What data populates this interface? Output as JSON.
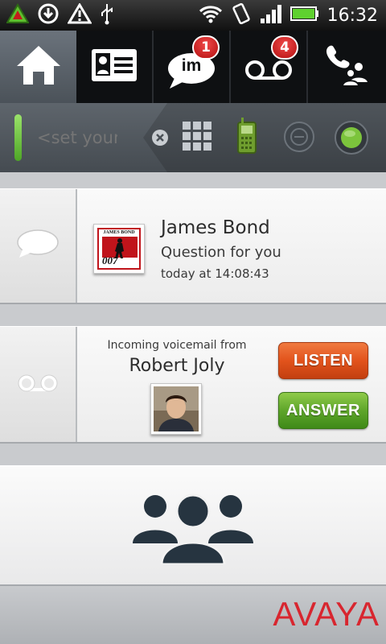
{
  "status_bar": {
    "time": "16:32",
    "icons": [
      "avaya-notification-icon",
      "download-icon",
      "warning-icon",
      "usb-icon",
      "wifi-icon",
      "vibrate-icon",
      "signal-icon",
      "battery-icon"
    ]
  },
  "nav": {
    "tabs": [
      {
        "name": "home",
        "icon": "home-icon"
      },
      {
        "name": "contacts",
        "icon": "contact-card-icon"
      },
      {
        "name": "im",
        "icon": "im-bubble-icon",
        "icon_text": "im",
        "badge": "1"
      },
      {
        "name": "voicemail",
        "icon": "voicemail-icon",
        "badge": "4"
      },
      {
        "name": "calls",
        "icon": "phone-group-icon"
      }
    ]
  },
  "presence": {
    "status_placeholder": "<set your s",
    "icons": [
      "clear-icon",
      "dialpad-icon",
      "mobile-phone-icon",
      "call-forward-icon",
      "availability-icon"
    ]
  },
  "message": {
    "avatar_label": "JAMES BOND",
    "avatar_number": "007",
    "name": "James Bond",
    "text": "Question for you",
    "time": "today at 14:08:43"
  },
  "voicemail": {
    "heading": "Incoming voicemail from",
    "caller": "Robert Joly",
    "listen_label": "LISTEN",
    "answer_label": "ANSWER"
  },
  "brand": {
    "name": "AVAYA"
  },
  "colors": {
    "accent_green": "#5ea52a",
    "listen_orange": "#e2531c",
    "badge_red": "#d21b1b",
    "brand_red": "#d8262f"
  }
}
